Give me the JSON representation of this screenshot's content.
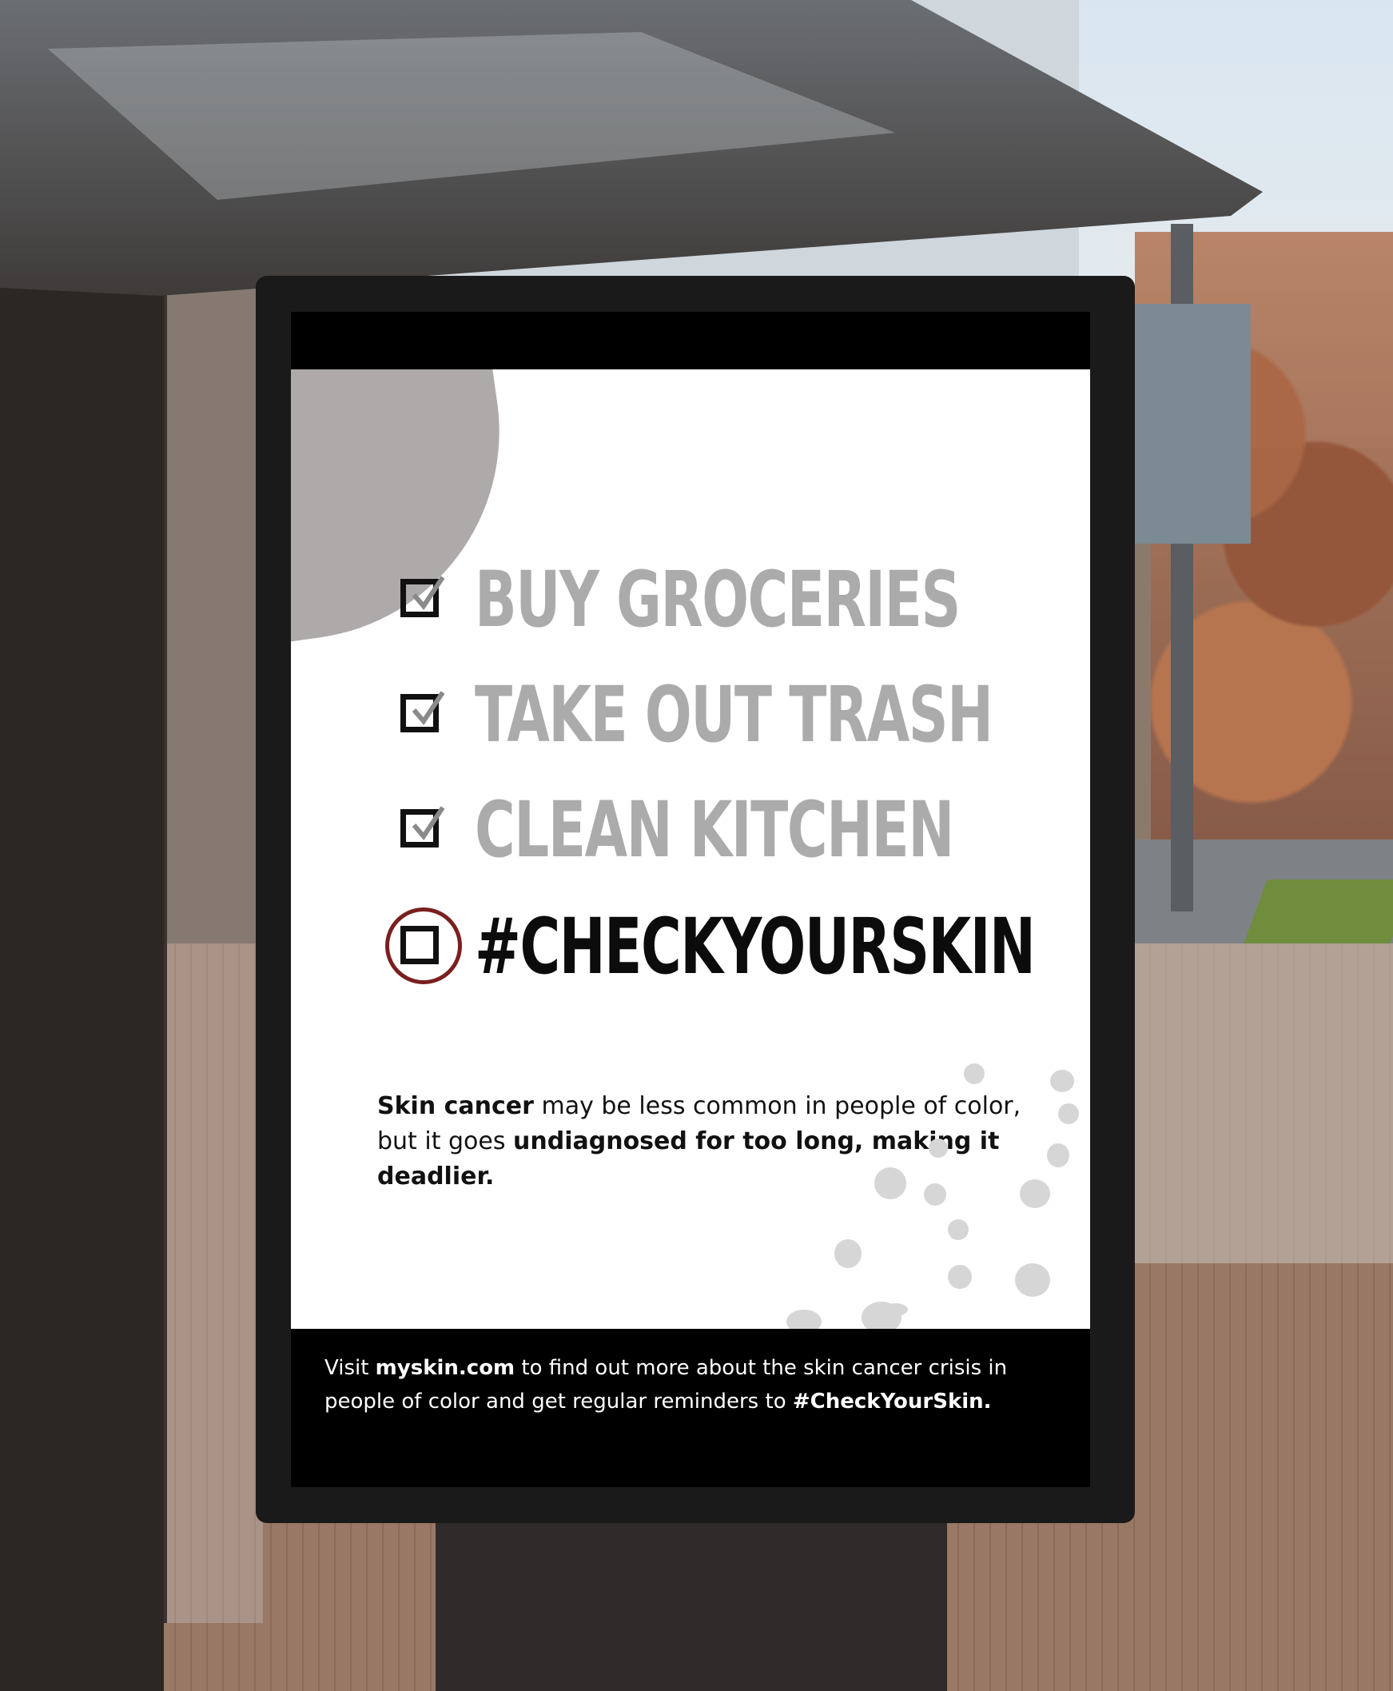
{
  "poster": {
    "checklist": [
      {
        "label": "BUY GROCERIES",
        "checked": true
      },
      {
        "label": "TAKE OUT TRASH",
        "checked": true
      },
      {
        "label": "CLEAN KITCHEN",
        "checked": true
      },
      {
        "label": "#CHECKYOURSKIN",
        "checked": false
      }
    ],
    "body": {
      "part1": "Skin cancer",
      "part2": " may be less common in people of color, but it goes ",
      "part3": "undiagnosed for too long, making it deadlier."
    },
    "footer": {
      "part1": "Visit ",
      "part2": "myskin.com",
      "part3": " to find out more about the skin cancer crisis in people of color and get regular reminders to ",
      "part4": "#CheckYourSkin."
    },
    "colors": {
      "accent_ring": "#7a1f1f",
      "muted_text": "#ababab",
      "blob": "#aeaaaa"
    }
  }
}
